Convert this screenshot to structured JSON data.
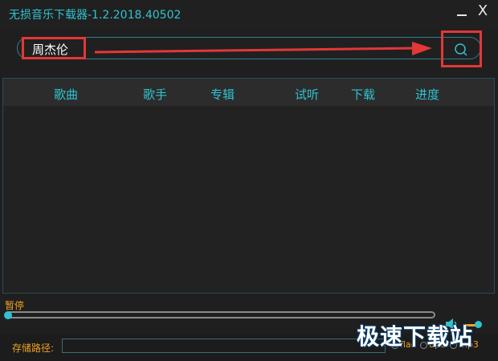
{
  "window": {
    "title": "无损音乐下载器-1.2.2018.40502",
    "close_label": "X"
  },
  "search": {
    "value": "周杰伦",
    "placeholder": ""
  },
  "list": {
    "columns": [
      "歌曲",
      "歌手",
      "专辑",
      "试听",
      "下载",
      "进度"
    ],
    "rows": []
  },
  "player": {
    "status": "暂停",
    "progress": 0
  },
  "footer": {
    "path_label": "存储路径:",
    "path_value": "",
    "format_options": [
      "flac",
      "ape",
      "mp3"
    ]
  },
  "watermark": "极速下载站",
  "colors": {
    "accent": "#2fc3d1",
    "status": "#f0a020",
    "highlight": "#e23838"
  }
}
